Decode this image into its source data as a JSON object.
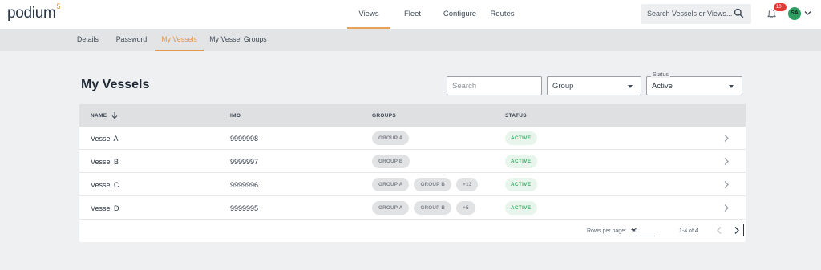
{
  "app": {
    "logo_text": "podium",
    "logo_sup": "5"
  },
  "nav": [
    {
      "label": "Views",
      "active": true
    },
    {
      "label": "Fleet",
      "active": false
    },
    {
      "label": "Configure",
      "active": false
    },
    {
      "label": "Routes",
      "active": false
    }
  ],
  "top_search": {
    "placeholder": "Search Vessels or Views..."
  },
  "notifications": {
    "badge": "10+"
  },
  "user": {
    "initials": "SA"
  },
  "subnav": [
    {
      "label": "Details",
      "active": false
    },
    {
      "label": "Password",
      "active": false
    },
    {
      "label": "My Vessels",
      "active": true
    },
    {
      "label": "My Vessel Groups",
      "active": false
    }
  ],
  "page": {
    "title": "My Vessels"
  },
  "filters": {
    "search_placeholder": "Search",
    "group_placeholder": "Group",
    "status_label": "Status",
    "status_value": "Active"
  },
  "table": {
    "columns": [
      "NAME",
      "IMO",
      "GROUPS",
      "STATUS"
    ],
    "rows": [
      {
        "name": "Vessel A",
        "imo": "9999998",
        "groups": [
          "GROUP A"
        ],
        "status": "ACTIVE"
      },
      {
        "name": "Vessel B",
        "imo": "9999997",
        "groups": [
          "GROUP B"
        ],
        "status": "ACTIVE"
      },
      {
        "name": "Vessel C",
        "imo": "9999996",
        "groups": [
          "GROUP A",
          "GROUP B",
          "+13"
        ],
        "status": "ACTIVE"
      },
      {
        "name": "Vessel D",
        "imo": "9999995",
        "groups": [
          "GROUP A",
          "GROUP B",
          "+5"
        ],
        "status": "ACTIVE"
      }
    ]
  },
  "pagination": {
    "rows_per_page_label": "Rows per page:",
    "rows_per_page": "10",
    "range": "1-4 of 4"
  },
  "colors": {
    "accent": "#e6964a",
    "status_green": "#3aa865",
    "badge_red": "#e53935"
  }
}
